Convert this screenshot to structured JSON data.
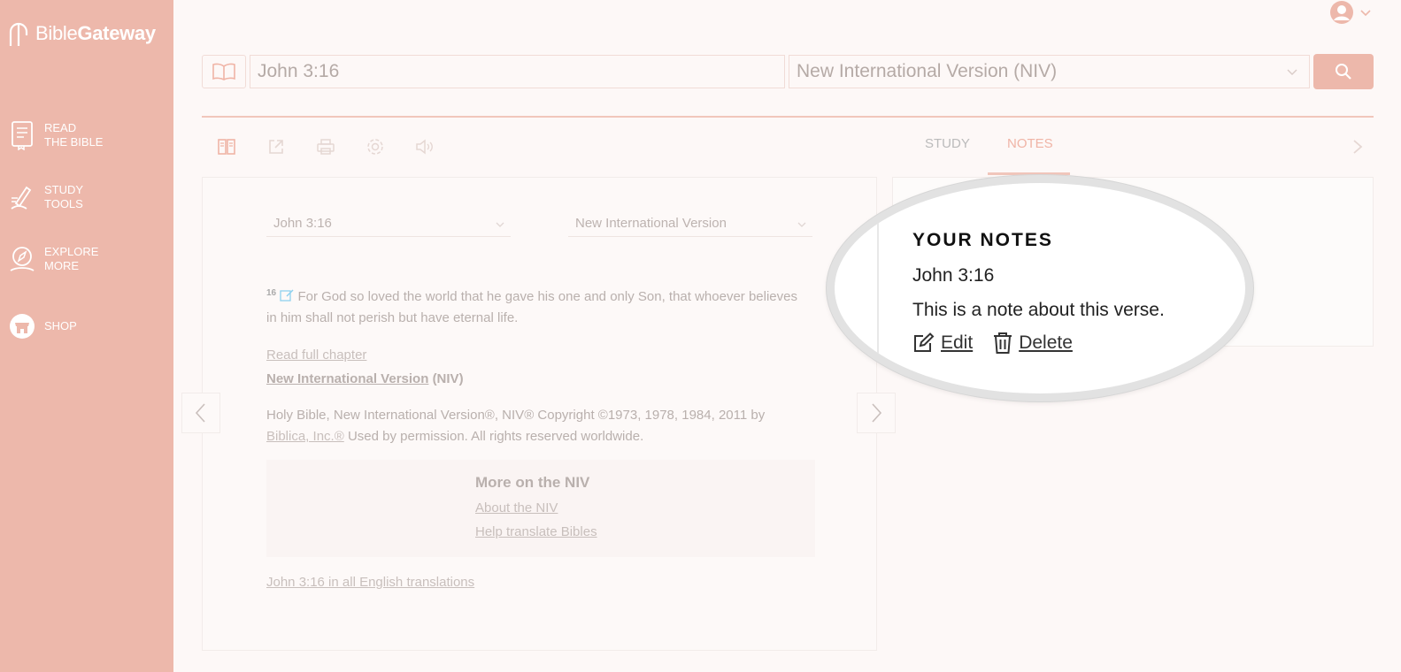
{
  "brand": {
    "name_light": "Bible",
    "name_bold": "Gateway"
  },
  "sidebar": {
    "items": [
      {
        "line1": "READ",
        "line2": "THE BIBLE"
      },
      {
        "line1": "STUDY",
        "line2": "TOOLS"
      },
      {
        "line1": "EXPLORE",
        "line2": "MORE"
      },
      {
        "line1": "SHOP",
        "line2": ""
      }
    ]
  },
  "search": {
    "query": "John 3:16",
    "version": "New International Version (NIV)"
  },
  "tabs": {
    "study": "STUDY",
    "notes": "NOTES"
  },
  "passage": {
    "reference_select": "John 3:16",
    "version_select": "New International Version",
    "verse_number": "16",
    "verse_text": "For God so loved the world that he gave his one and only Son, that whoever believes in him shall not perish but have eternal life.",
    "read_full_chapter": "Read full chapter",
    "version_link": "New International Version",
    "version_abbr": "(NIV)",
    "copyright_text": "Holy Bible, New International Version®, NIV® Copyright ©1973, 1978, 1984, 2011 by",
    "publisher_link": "Biblica, Inc.®",
    "permission_text": "Used by permission. All rights reserved worldwide.",
    "more_title": "More on the NIV",
    "about_link": "About the NIV",
    "help_link": "Help translate Bibles",
    "all_translations_link": "John 3:16 in all English translations"
  },
  "notes": {
    "heading": "YOUR NOTES",
    "reference": "John 3:16",
    "text": "This is a note about this verse.",
    "edit_label": "Edit",
    "delete_label": "Delete"
  },
  "colors": {
    "accent": "#edb8ab",
    "page": "#fdf8f7"
  }
}
